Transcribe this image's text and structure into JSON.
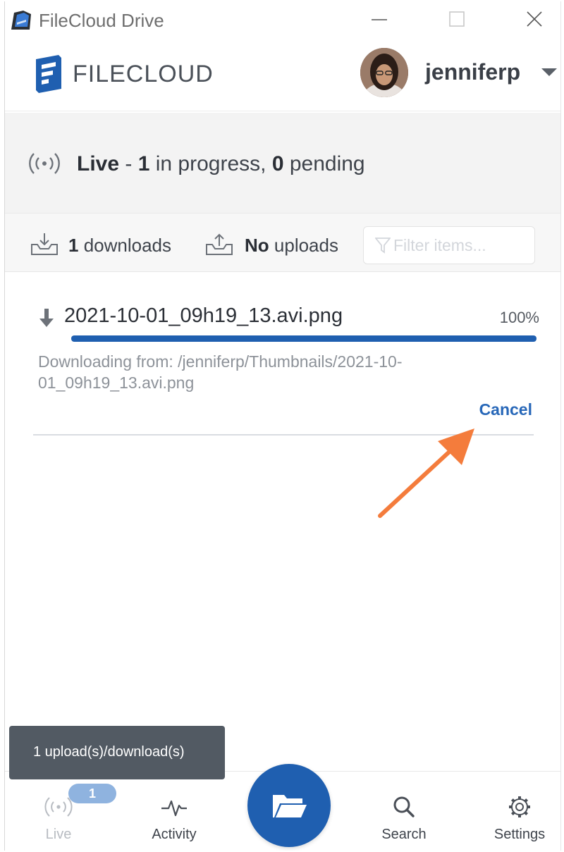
{
  "window": {
    "title": "FileCloud Drive"
  },
  "header": {
    "logo_text": "FILECLOUD",
    "username": "jenniferp"
  },
  "status": {
    "mode": "Live",
    "separator": " - ",
    "in_progress_count": "1",
    "in_progress_text": " in progress, ",
    "pending_count": "0",
    "pending_text": " pending"
  },
  "transfers": {
    "downloads_count": "1",
    "downloads_text": " downloads",
    "uploads_count": "No",
    "uploads_text": " uploads",
    "filter_placeholder": "Filter items..."
  },
  "download_item": {
    "filename": "2021-10-01_09h19_13.avi.png",
    "percent_text": "100%",
    "progress": 1.0,
    "path_text": "Downloading from: /jenniferp/Thumbnails/2021-10-01_09h19_13.avi.png",
    "cancel_label": "Cancel"
  },
  "toast": {
    "text": "1 upload(s)/download(s)"
  },
  "bottom_nav": {
    "live_label": "Live",
    "live_badge": "1",
    "activity_label": "Activity",
    "search_label": "Search",
    "settings_label": "Settings"
  },
  "colors": {
    "brand_blue": "#1f5fb0",
    "link_blue": "#2767b8",
    "annotation_orange": "#f47c3c",
    "toast_bg": "#525a63"
  },
  "icons": {
    "app": "filecloud-app-icon",
    "live": "broadcast-icon",
    "download": "tray-download-icon",
    "upload": "tray-upload-icon",
    "filter": "funnel-icon",
    "item_download": "arrow-down-icon",
    "activity": "pulse-icon",
    "folder": "folder-open-icon",
    "search": "magnifier-icon",
    "settings": "gear-icon"
  }
}
